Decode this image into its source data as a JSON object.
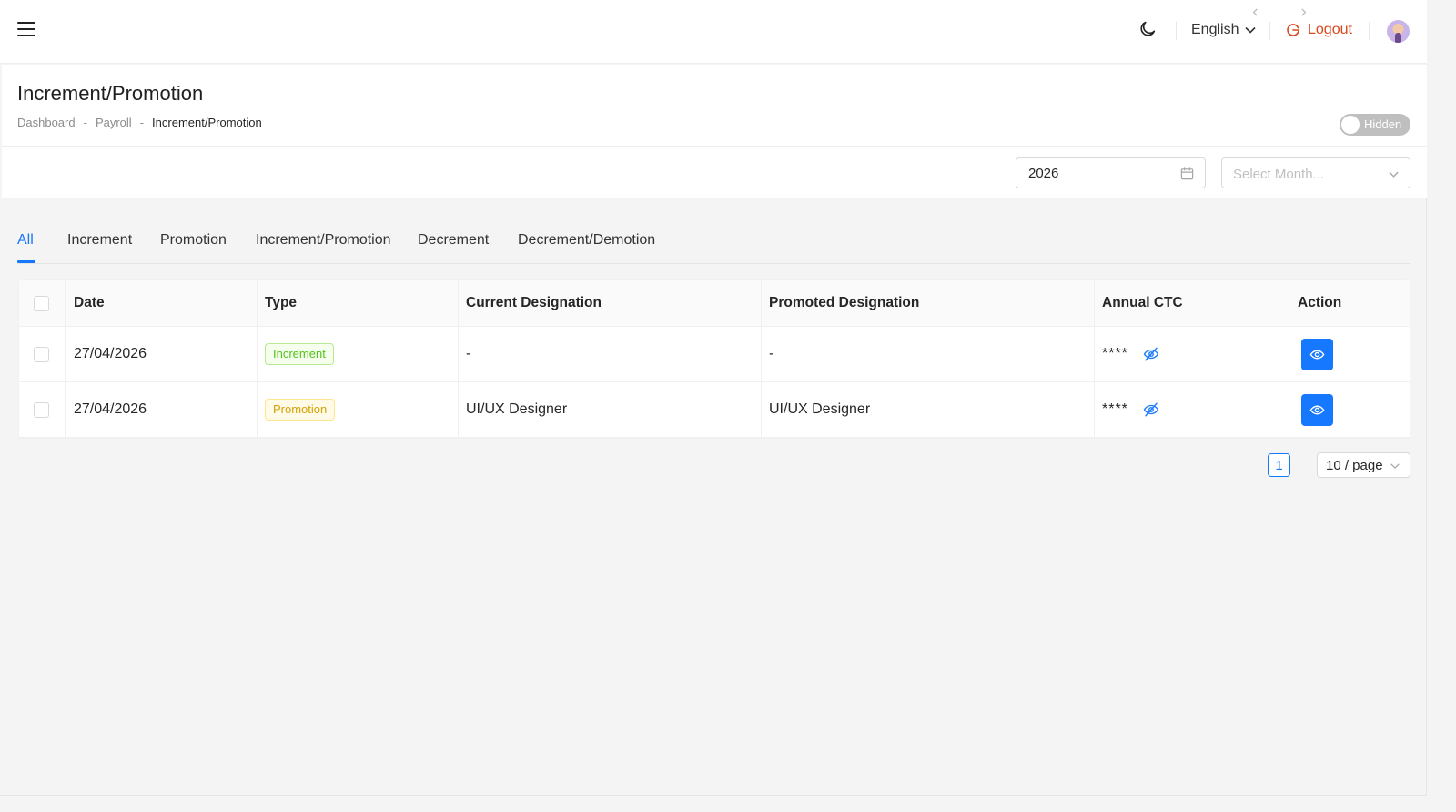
{
  "header": {
    "language": "English",
    "logout_label": "Logout"
  },
  "page": {
    "title": "Increment/Promotion",
    "breadcrumb": [
      "Dashboard",
      "Payroll",
      "Increment/Promotion"
    ],
    "breadcrumb_separator": "-",
    "visibility_toggle": {
      "label": "Hidden",
      "on": false
    }
  },
  "filters": {
    "year": "2026",
    "month_placeholder": "Select Month..."
  },
  "tabs": [
    {
      "label": "All",
      "active": true
    },
    {
      "label": "Increment",
      "active": false
    },
    {
      "label": "Promotion",
      "active": false
    },
    {
      "label": "Increment/Promotion",
      "active": false
    },
    {
      "label": "Decrement",
      "active": false
    },
    {
      "label": "Decrement/Demotion",
      "active": false
    }
  ],
  "table": {
    "columns": [
      "Date",
      "Type",
      "Current Designation",
      "Promoted Designation",
      "Annual CTC",
      "Action"
    ],
    "rows": [
      {
        "date": "27/04/2026",
        "type": "Increment",
        "type_color": "green",
        "current": "-",
        "promoted": "-",
        "ctc": "****"
      },
      {
        "date": "27/04/2026",
        "type": "Promotion",
        "type_color": "gold",
        "current": "UI/UX Designer",
        "promoted": "UI/UX Designer",
        "ctc": "****"
      }
    ]
  },
  "pagination": {
    "current_page": "1",
    "page_size": "10 / page"
  },
  "colors": {
    "primary": "#1677ff",
    "logout": "#d9481d",
    "increment_tag": "#52c41a",
    "promotion_tag": "#d4a106"
  }
}
